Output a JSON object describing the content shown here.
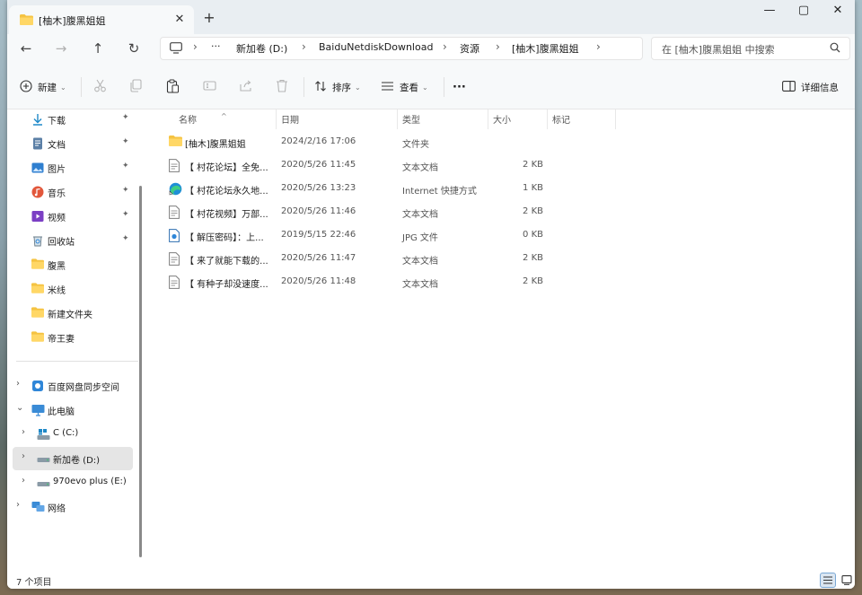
{
  "window": {
    "tab_title": "[柚木]腹黑姐姐",
    "tab_close": "✕",
    "new_tab": "+",
    "controls": {
      "minimize": "—",
      "maximize": "▢",
      "close": "✕"
    }
  },
  "nav": {
    "back": "←",
    "forward": "→",
    "up": "↑",
    "refresh": "↻",
    "more": "···",
    "breadcrumbs": [
      "新加卷 (D:)",
      "BaiduNetdiskDownload",
      "资源",
      "[柚木]腹黑姐姐"
    ],
    "search_placeholder": "在 [柚木]腹黑姐姐 中搜索"
  },
  "toolbar": {
    "new_label": "新建",
    "sort_label": "排序",
    "view_label": "查看",
    "more_label": "···",
    "details_label": "详细信息"
  },
  "sidebar": {
    "quick_access": [
      {
        "label": "下载",
        "icon": "download-icon",
        "pinned": true
      },
      {
        "label": "文档",
        "icon": "document-icon",
        "pinned": true
      },
      {
        "label": "图片",
        "icon": "picture-icon",
        "pinned": true
      },
      {
        "label": "音乐",
        "icon": "music-icon",
        "pinned": true
      },
      {
        "label": "视频",
        "icon": "video-icon",
        "pinned": true
      },
      {
        "label": "回收站",
        "icon": "recycle-bin-icon",
        "pinned": true
      },
      {
        "label": "腹黑",
        "icon": "folder-icon",
        "pinned": false
      },
      {
        "label": "米线",
        "icon": "folder-icon",
        "pinned": false
      },
      {
        "label": "新建文件夹",
        "icon": "folder-icon",
        "pinned": false
      },
      {
        "label": "帝王妻",
        "icon": "folder-icon",
        "pinned": false
      }
    ],
    "tree": [
      {
        "label": "百度网盘同步空间",
        "icon": "baidu-sync-icon",
        "expander": "›"
      },
      {
        "label": "此电脑",
        "icon": "computer-icon",
        "expander": "⌄"
      },
      {
        "label": "C (C:)",
        "icon": "drive-c-icon",
        "expander": "›"
      },
      {
        "label": "新加卷 (D:)",
        "icon": "drive-icon",
        "expander": "›",
        "selected": true
      },
      {
        "label": "970evo plus (E:)",
        "icon": "drive-icon",
        "expander": "›"
      },
      {
        "label": "网络",
        "icon": "network-icon",
        "expander": "›"
      }
    ],
    "pin_glyph": "📌"
  },
  "columns": {
    "name": "名称",
    "date": "日期",
    "type": "类型",
    "size": "大小",
    "tags": "标记",
    "sort_glyph": "^"
  },
  "files": [
    {
      "name": "[柚木]腹黑姐姐",
      "date": "2024/2/16 17:06",
      "type": "文件夹",
      "size": "",
      "icon": "folder-icon"
    },
    {
      "name": "【 村花论坛】全免...",
      "date": "2020/5/26 11:45",
      "type": "文本文档",
      "size": "2 KB",
      "icon": "text-file-icon"
    },
    {
      "name": "【 村花论坛永久地...",
      "date": "2020/5/26 13:23",
      "type": "Internet 快捷方式",
      "size": "1 KB",
      "icon": "edge-shortcut-icon"
    },
    {
      "name": "【 村花视频】万部...",
      "date": "2020/5/26 11:46",
      "type": "文本文档",
      "size": "2 KB",
      "icon": "text-file-icon"
    },
    {
      "name": "【 解压密码】：上...",
      "date": "2019/5/15 22:46",
      "type": "JPG 文件",
      "size": "0 KB",
      "icon": "image-file-icon"
    },
    {
      "name": "【 来了就能下载的...",
      "date": "2020/5/26 11:47",
      "type": "文本文档",
      "size": "2 KB",
      "icon": "text-file-icon"
    },
    {
      "name": "【 有种子却没速度...",
      "date": "2020/5/26 11:48",
      "type": "文本文档",
      "size": "2 KB",
      "icon": "text-file-icon"
    }
  ],
  "status": {
    "item_count": "7 个项目"
  },
  "colors": {
    "accent": "#0067c0",
    "folder": "#f5c342",
    "selection": "#e5e5e5"
  }
}
